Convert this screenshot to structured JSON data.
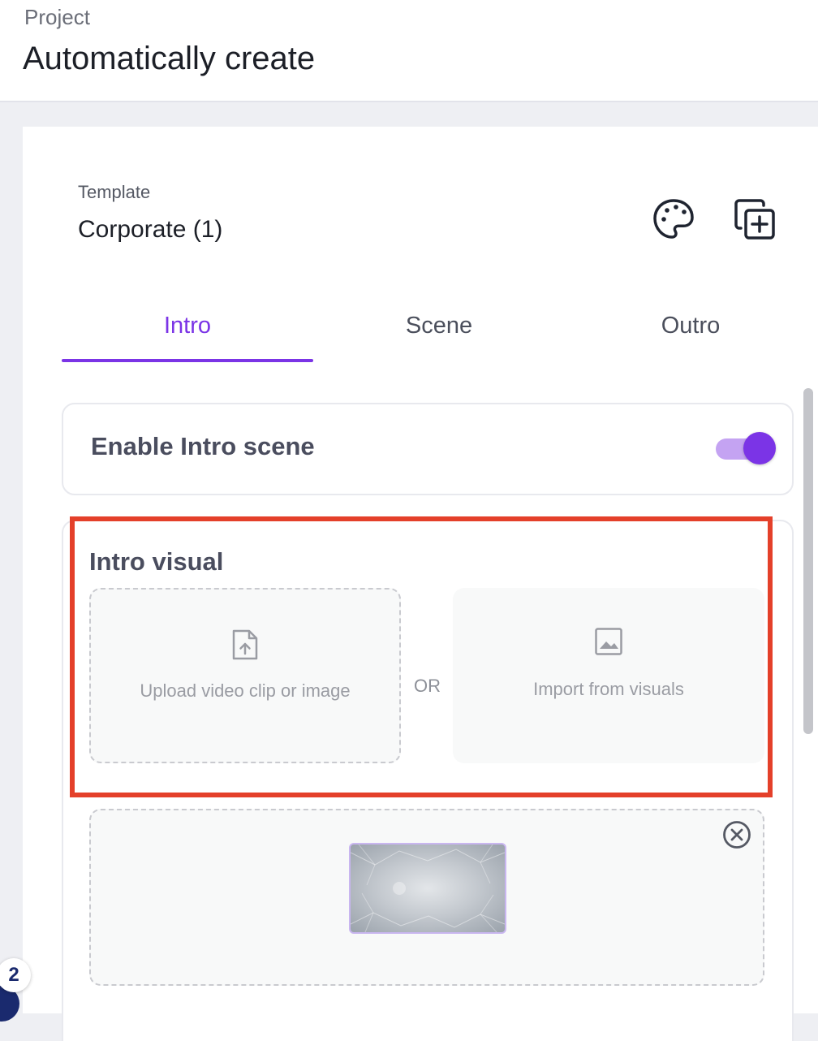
{
  "header": {
    "breadcrumb": "Project",
    "title": "Automatically create"
  },
  "template": {
    "label": "Template",
    "name": "Corporate (1)"
  },
  "tabs": [
    {
      "label": "Intro",
      "active": true
    },
    {
      "label": "Scene",
      "active": false
    },
    {
      "label": "Outro",
      "active": false
    }
  ],
  "intro": {
    "enable_label": "Enable Intro scene",
    "enabled": true,
    "visual_title": "Intro visual",
    "upload_text": "Upload video clip or image",
    "or_text": "OR",
    "import_text": "Import from visuals"
  },
  "notification_count": "2",
  "colors": {
    "accent": "#7b34e6",
    "highlight": "#e4402a"
  }
}
